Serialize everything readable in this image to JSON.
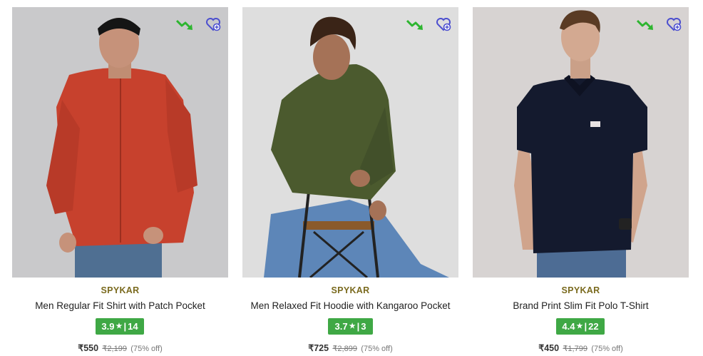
{
  "products": [
    {
      "brand": "SPYKAR",
      "title": "Men Regular Fit Shirt with Patch Pocket",
      "rating": "3.9",
      "reviews": "14",
      "price": "₹550",
      "mrp": "₹2,199",
      "discount": "(75% off)",
      "image_colors": {
        "background": "#c9c9cb",
        "garment": "#c7412d",
        "pants": "#4f6f92"
      }
    },
    {
      "brand": "SPYKAR",
      "title": "Men Relaxed Fit Hoodie with Kangaroo Pocket",
      "rating": "3.7",
      "reviews": "3",
      "price": "₹725",
      "mrp": "₹2,899",
      "discount": "(75% off)",
      "image_colors": {
        "background": "#dedede",
        "garment": "#4b5a2e",
        "pants": "#5d86b8"
      }
    },
    {
      "brand": "SPYKAR",
      "title": "Brand Print Slim Fit Polo T-Shirt",
      "rating": "4.4",
      "reviews": "22",
      "price": "₹450",
      "mrp": "₹1,799",
      "discount": "(75% off)",
      "image_colors": {
        "background": "#d7d3d2",
        "garment": "#141a2e",
        "pants": "#4d6c94"
      }
    }
  ],
  "icons": {
    "trend": "price-drop-trend-icon",
    "wishlist": "add-to-wishlist-heart-icon",
    "star": "★",
    "separator": "|"
  },
  "colors": {
    "brand_text": "#7a6a1e",
    "rating_badge": "#3fa845",
    "trend_icon": "#2db52f",
    "wishlist_icon": "#4c4fcf"
  }
}
